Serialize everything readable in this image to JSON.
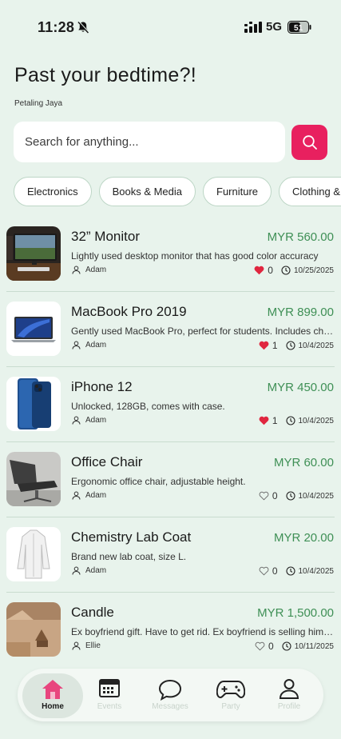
{
  "status_bar": {
    "time": "11:28",
    "network": "5G",
    "battery": "51"
  },
  "header": {
    "title": "Past your bedtime?!",
    "location": "Petaling Jaya"
  },
  "search": {
    "placeholder": "Search for anything..."
  },
  "categories": [
    "Electronics",
    "Books & Media",
    "Furniture",
    "Clothing & Accessories"
  ],
  "listings": [
    {
      "title": "32” Monitor",
      "price": "MYR 560.00",
      "description": "Lightly used desktop monitor that has good color accuracy",
      "seller": "Adam",
      "likes": "0",
      "liked": true,
      "date": "10/25/2025",
      "image": "monitor"
    },
    {
      "title": "MacBook Pro 2019",
      "price": "MYR 899.00",
      "description": "Gently used MacBook Pro, perfect for students. Includes charger.",
      "seller": "Adam",
      "likes": "1",
      "liked": true,
      "date": "10/4/2025",
      "image": "laptop"
    },
    {
      "title": "iPhone 12",
      "price": "MYR 450.00",
      "description": "Unlocked, 128GB, comes with case.",
      "seller": "Adam",
      "likes": "1",
      "liked": true,
      "date": "10/4/2025",
      "image": "phone"
    },
    {
      "title": "Office Chair",
      "price": "MYR 60.00",
      "description": "Ergonomic office chair, adjustable height.",
      "seller": "Adam",
      "likes": "0",
      "liked": false,
      "date": "10/4/2025",
      "image": "chair"
    },
    {
      "title": "Chemistry Lab Coat",
      "price": "MYR 20.00",
      "description": "Brand new lab coat, size L.",
      "seller": "Adam",
      "likes": "0",
      "liked": false,
      "date": "10/4/2025",
      "image": "labcoat"
    },
    {
      "title": "Candle",
      "price": "MYR 1,500.00",
      "description": "Ex boyfriend gift. Have to get rid. Ex boyfriend is selling himself",
      "seller": "Ellie",
      "likes": "0",
      "liked": false,
      "date": "10/11/2025",
      "image": "candle"
    }
  ],
  "nav": [
    {
      "label": "Home",
      "icon": "home-icon",
      "active": true
    },
    {
      "label": "Events",
      "icon": "calendar-icon",
      "active": false
    },
    {
      "label": "Messages",
      "icon": "chat-bubble-icon",
      "active": false
    },
    {
      "label": "Party",
      "icon": "gamepad-icon",
      "active": false
    },
    {
      "label": "Profile",
      "icon": "user-icon",
      "active": false
    }
  ],
  "colors": {
    "background": "#e8f3ec",
    "accent": "#e8205f",
    "price": "#3e8f55",
    "heart": "#e0263f"
  }
}
